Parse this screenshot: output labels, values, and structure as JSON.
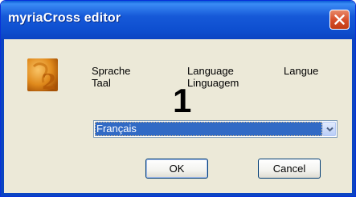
{
  "window": {
    "title": "myriaCross editor"
  },
  "icons": {
    "app": "app-logo-icon",
    "close": "close-icon",
    "dropdown": "chevron-down-icon"
  },
  "languages_prompt": {
    "de": "Sprache",
    "en": "Language",
    "fr": "Langue",
    "nl": "Taal",
    "pt": "Linguagem"
  },
  "step_marker": "1",
  "language_select": {
    "selected": "Français"
  },
  "buttons": {
    "ok": "OK",
    "cancel": "Cancel"
  },
  "colors": {
    "titlebar": "#0b44c2",
    "window_bg": "#ece9d8",
    "selection": "#316ac5",
    "close_button": "#d8502c"
  }
}
